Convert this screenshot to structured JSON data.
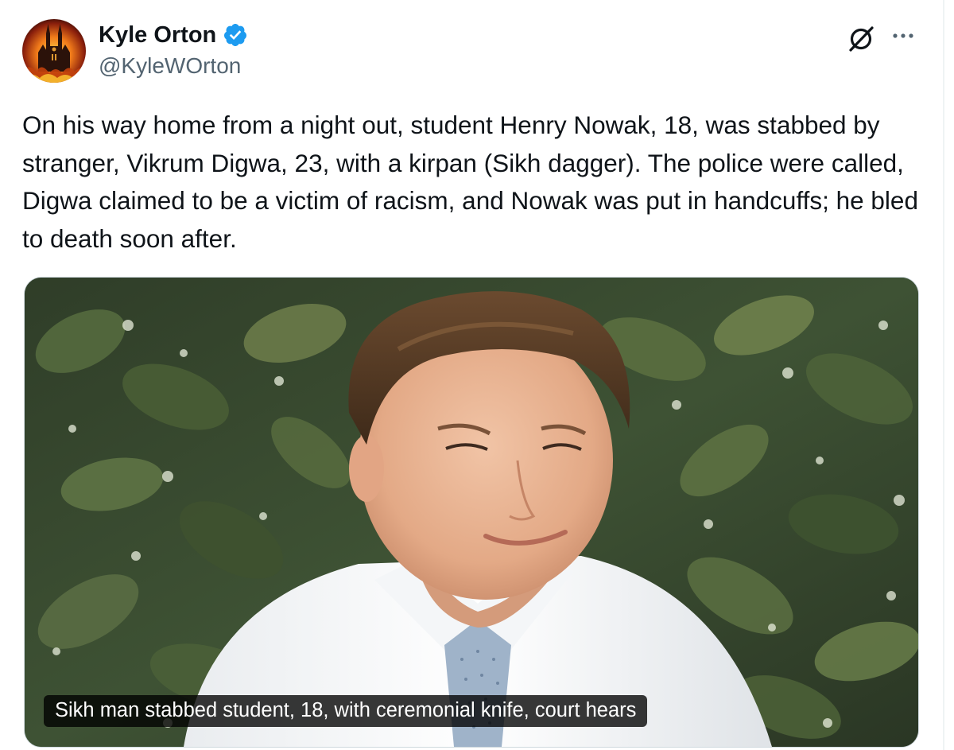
{
  "author": {
    "display_name": "Kyle Orton",
    "handle": "@KyleWOrton",
    "verified": true,
    "avatar_icon": "burning-cathedral-avatar"
  },
  "actions": {
    "grok_icon": "grok-icon",
    "more_icon": "more-icon"
  },
  "tweet": {
    "text": "On his way home from a night out, student Henry Nowak, 18, was stabbed by stranger, Vikrum Digwa, 23, with a kirpan (Sikh dagger). The police were called, Digwa claimed to be a victim of racism, and Nowak was put in handcuffs; he bled to death soon after."
  },
  "media": {
    "caption": "Sikh man stabbed student, 18, with ceremonial knife, court hears"
  },
  "colors": {
    "text": "#0f1419",
    "secondary": "#536471",
    "verified": "#1d9bf0",
    "border": "#cfd9de"
  }
}
